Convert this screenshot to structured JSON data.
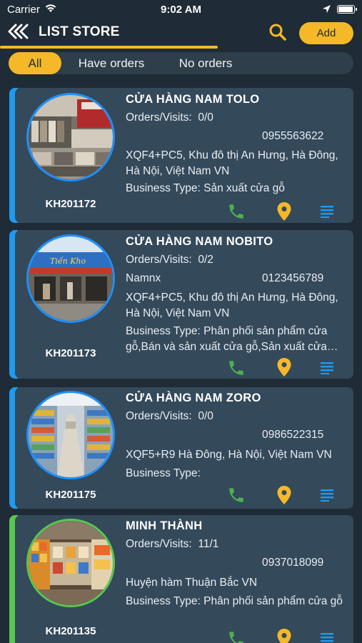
{
  "status_bar": {
    "carrier": "Carrier",
    "time": "9:02 AM"
  },
  "header": {
    "title": "LIST STORE",
    "add_label": "Add"
  },
  "colors": {
    "accent": "#f5b829",
    "background": "#1f2b36",
    "card": "#34495a",
    "call": "#4caf50",
    "stripe_blue": "#1e9bf0",
    "stripe_green": "#58c850"
  },
  "tabs": [
    {
      "label": "All",
      "active": true
    },
    {
      "label": "Have orders",
      "active": false
    },
    {
      "label": "No orders",
      "active": false
    }
  ],
  "stores": [
    {
      "name": "CỬA HÀNG NAM TOLO",
      "orders_visits_label": "Orders/Visits:",
      "orders_visits": "0/0",
      "contact": "",
      "phone": "0955563622",
      "address": "XQF4+PC5, Khu đô thị An Hưng, Hà Đông, Hà Nội, Việt Nam  VN",
      "business_type": "Business Type: Sản xuất cửa gỗ",
      "code": "KH201172",
      "stripe": "blue",
      "photo": "tile-shop"
    },
    {
      "name": "CỬA HÀNG NAM NOBITO",
      "orders_visits_label": "Orders/Visits:",
      "orders_visits": "0/2",
      "contact": "Namnx",
      "phone": "0123456789",
      "address": "XQF4+PC5, Khu đô thị An Hưng, Hà Đông, Hà Nội, Việt Nam  VN",
      "business_type": "Business Type: Phân phối sản phẩm cửa gỗ,Bán và sản xuất cửa gỗ,Sản xuất cửa…",
      "code": "KH201173",
      "stripe": "blue",
      "photo": "storefront"
    },
    {
      "name": "CỬA HÀNG NAM ZORO",
      "orders_visits_label": "Orders/Visits:",
      "orders_visits": "0/0",
      "contact": "",
      "phone": "0986522315",
      "address": "XQF5+R9 Hà Đông, Hà Nội, Việt Nam  VN",
      "business_type": "Business Type:",
      "code": "KH201175",
      "stripe": "blue",
      "photo": "aisle"
    },
    {
      "name": "MINH THÀNH",
      "orders_visits_label": "Orders/Visits:",
      "orders_visits": "11/1",
      "contact": "",
      "phone": "0937018099",
      "address": "Huyện hàm Thuận Bắc  VN",
      "business_type": "Business Type: Phân phối sản phẩm cửa gỗ",
      "code": "KH201135",
      "stripe": "green",
      "photo": "paint-shop"
    }
  ]
}
